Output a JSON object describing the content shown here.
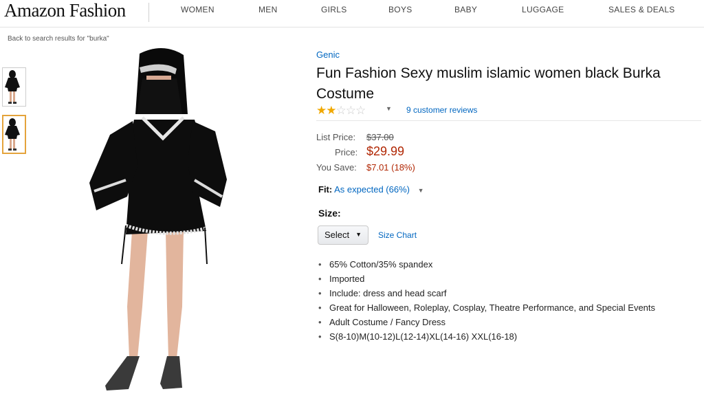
{
  "header": {
    "logo": "Amazon Fashion",
    "nav": [
      "WOMEN",
      "MEN",
      "GIRLS",
      "BOYS",
      "BABY",
      "LUGGAGE",
      "SALES & DEALS"
    ]
  },
  "breadcrumb": "Back to search results for \"burka\"",
  "product": {
    "brand": "Genic",
    "title": "Fun Fashion Sexy muslim islamic women black Burka Costume",
    "rating": {
      "stars_filled": 2,
      "stars_total": 5,
      "reviews_text": "9 customer reviews"
    },
    "list_price_label": "List Price:",
    "list_price": "$37.00",
    "price_label": "Price:",
    "price": "$29.99",
    "you_save_label": "You Save:",
    "you_save": "$7.01 (18%)",
    "fit_label": "Fit:",
    "fit_value": "As expected (66%)",
    "size_label": "Size:",
    "size_select": "Select",
    "size_chart": "Size Chart",
    "bullets": [
      "65% Cotton/35% spandex",
      "Imported",
      "Include: dress and head scarf",
      "Great for Halloween, Roleplay, Cosplay, Theatre Performance, and Special Events",
      "Adult Costume / Fancy Dress",
      "S(8-10)M(10-12)L(12-14)XL(14-16) XXL(16-18)"
    ]
  },
  "colors": {
    "link": "#0066c0",
    "price": "#b12704",
    "star": "#f0a800",
    "thumb_selected": "#e4a33b"
  },
  "icons": {
    "rating_caret": "caret-down-icon",
    "fit_caret": "caret-down-icon",
    "select_caret": "caret-down-icon"
  }
}
